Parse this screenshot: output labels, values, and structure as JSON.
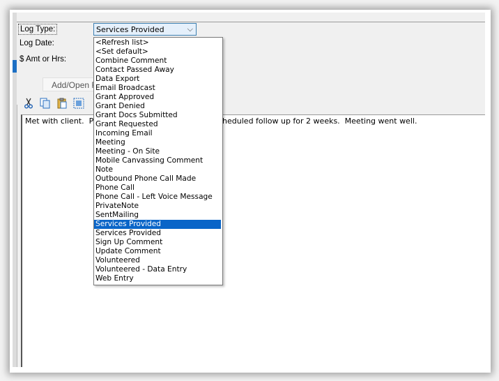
{
  "form": {
    "log_type_label": "Log Type:",
    "log_date_label": "Log Date:",
    "amt_label": "$ Amt or Hrs:",
    "log_type_value": "Services Provided",
    "add_button_label": "Add/Open Re"
  },
  "editor": {
    "text_start": "Met with client.  Pro",
    "text_end": "cheduled follow up for 2 weeks.  Meeting went well."
  },
  "toolbar": {
    "icons": [
      "scissors-icon",
      "copy-icon",
      "paste-icon",
      "select-all-icon"
    ]
  },
  "dropdown": {
    "selected_index": 20,
    "items": [
      "<Refresh list>",
      "<Set default>",
      "Combine Comment",
      "Contact Passed Away",
      "Data Export",
      "Email Broadcast",
      "Grant Approved",
      "Grant Denied",
      "Grant Docs Submitted",
      "Grant Requested",
      "Incoming Email",
      "Meeting",
      "Meeting - On Site",
      "Mobile Canvassing Comment",
      "Note",
      "Outbound Phone Call Made",
      "Phone Call",
      "Phone Call - Left Voice Message",
      "PrivateNote",
      "SentMailing",
      "Services Provided",
      "Services Provided",
      "Sign Up Comment",
      "Update Comment",
      "Volunteered",
      "Volunteered - Data Entry",
      "Web Entry"
    ]
  },
  "colors": {
    "selection": "#0a65c8",
    "combo_bg": "#e5f0fb",
    "accent": "#1c6fc4"
  }
}
